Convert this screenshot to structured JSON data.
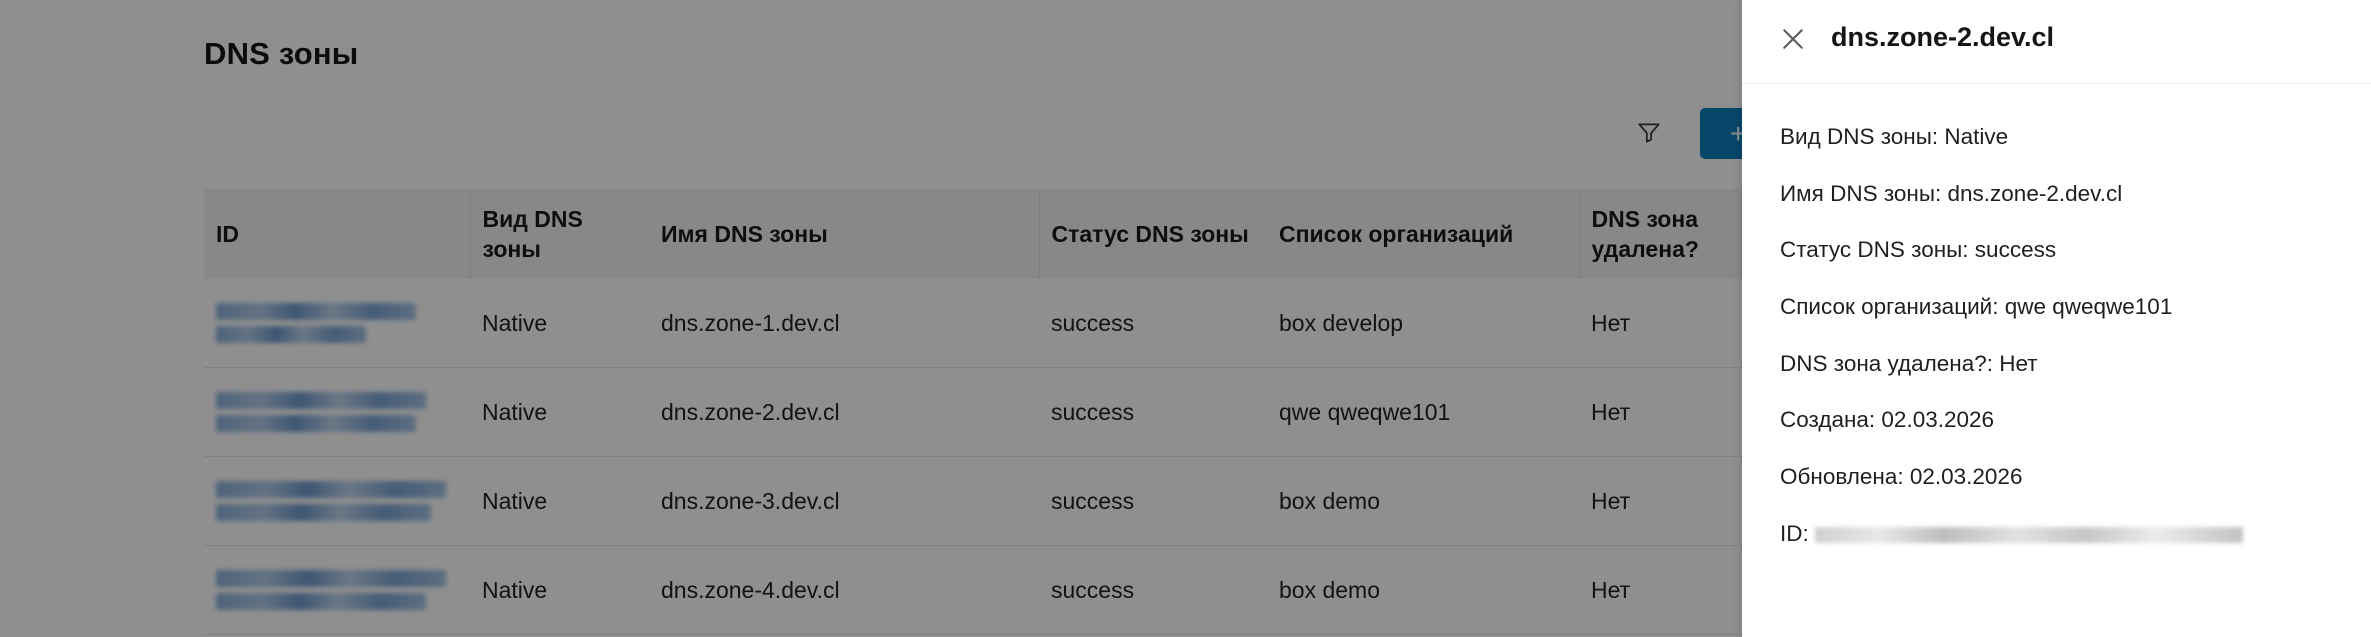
{
  "page": {
    "title": "DNS зоны"
  },
  "toolbar": {
    "add_label": "+",
    "filter_icon": "filter-icon"
  },
  "table": {
    "columns": [
      "ID",
      "Вид DNS зоны",
      "Имя DNS зоны",
      "Статус DNS зоны",
      "Список организаций",
      "DNS зона удалена?"
    ],
    "rows": [
      {
        "type": "Native",
        "name": "dns.zone-1.dev.cl",
        "status": "success",
        "orgs": "box develop",
        "deleted": "Нет"
      },
      {
        "type": "Native",
        "name": "dns.zone-2.dev.cl",
        "status": "success",
        "orgs": "qwe qweqwe101",
        "deleted": "Нет"
      },
      {
        "type": "Native",
        "name": "dns.zone-3.dev.cl",
        "status": "success",
        "orgs": "box demo",
        "deleted": "Нет"
      },
      {
        "type": "Native",
        "name": "dns.zone-4.dev.cl",
        "status": "success",
        "orgs": "box demo",
        "deleted": "Нет"
      }
    ]
  },
  "panel": {
    "title": "dns.zone-2.dev.cl",
    "fields": [
      "Вид DNS зоны: Native",
      "Имя DNS зоны: dns.zone-2.dev.cl",
      "Статус DNS зоны: success",
      "Список организаций: qwe qweqwe101",
      "DNS зона удалена?: Нет",
      "Создана: 02.03.2026",
      "Обновлена: 02.03.2026"
    ],
    "id_label": "ID:"
  },
  "colors": {
    "accent": "#0b7ebc",
    "overlay": "#000000"
  }
}
